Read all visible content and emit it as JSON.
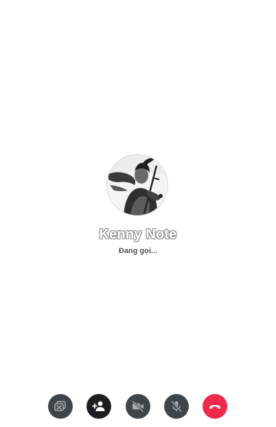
{
  "caller": {
    "name": "Kenny Note",
    "status": "Đang gọi..."
  },
  "controls": [
    {
      "icon": "screen-share-off-icon",
      "state": "disabled"
    },
    {
      "icon": "add-person-icon",
      "state": "active"
    },
    {
      "icon": "video-off-icon",
      "state": "disabled"
    },
    {
      "icon": "mic-off-icon",
      "state": "disabled"
    },
    {
      "icon": "end-call-icon",
      "state": "danger"
    }
  ],
  "colors": {
    "background": "#ffffff",
    "control_disabled": "#3f4449",
    "control_active": "#1c1e21",
    "end_call": "#f02849",
    "status_text": "#555555"
  }
}
